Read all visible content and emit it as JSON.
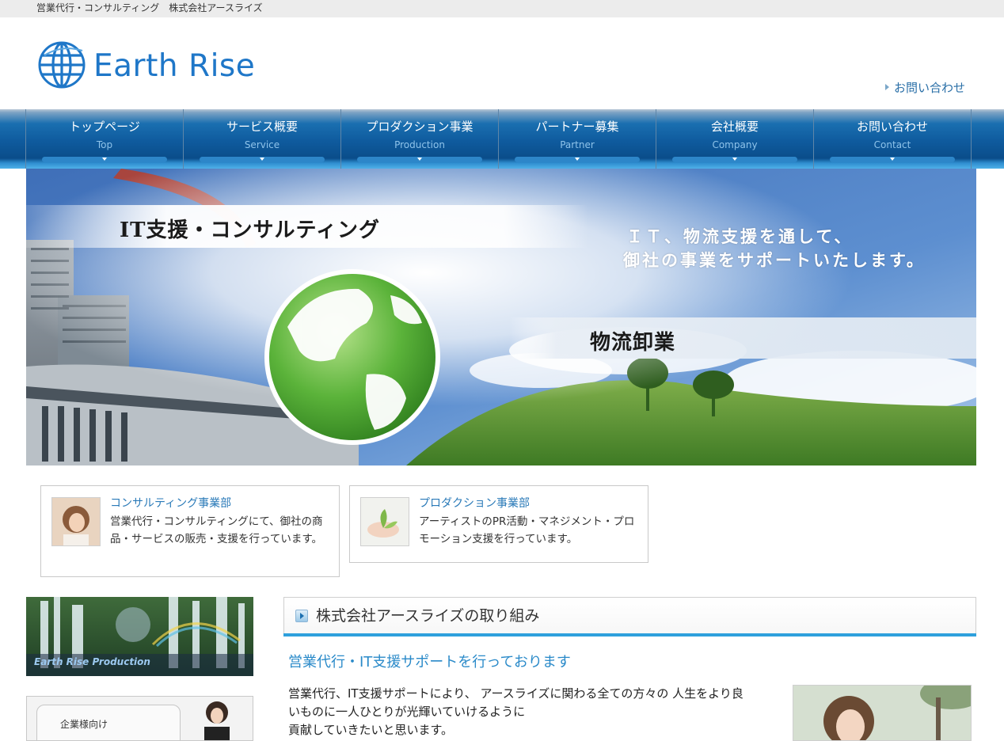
{
  "topbar": {
    "text": "営業代行・コンサルティング　株式会社アースライズ"
  },
  "header": {
    "logo_text": "Earth Rise",
    "contact_link": "お問い合わせ"
  },
  "nav": {
    "items": [
      {
        "jp": "トップページ",
        "en": "Top"
      },
      {
        "jp": "サービス概要",
        "en": "Service"
      },
      {
        "jp": "プロダクション事業",
        "en": "Production"
      },
      {
        "jp": "パートナー募集",
        "en": "Partner"
      },
      {
        "jp": "会社概要",
        "en": "Company"
      },
      {
        "jp": "お問い合わせ",
        "en": "Contact"
      }
    ]
  },
  "hero": {
    "label_it": "IT支援・コンサルティング",
    "label_logistics": "物流卸業",
    "slogan_line1": "ＩＴ、物流支援を通して、",
    "slogan_line2": "御社の事業をサポートいたします。"
  },
  "cards": [
    {
      "title": "コンサルティング事業部",
      "desc": "営業代行・コンサルティングにて、御社の商品・サービスの販売・支援を行っています。"
    },
    {
      "title": "プロダクション事業部",
      "desc": "アーティストのPR活動・マネジメント・プロモーション支援を行っています。"
    }
  ],
  "sidebar": {
    "banner1_text": "Earth Rise Production",
    "banner2_text": "企業様向け"
  },
  "main": {
    "section_title": "株式会社アースライズの取り組み",
    "sub_heading": "営業代行・IT支援サポートを行っております",
    "body_line1": "営業代行、IT支援サポートにより、 アースライズに関わる全ての方々の 人生をより良",
    "body_line2": "いものに一人ひとりが光輝いていけるように",
    "body_line3": "貢献していきたいと思います。"
  },
  "colors": {
    "accent": "#2ea0dc",
    "link": "#2a7ab8",
    "nav_dark": "#0f5b9e"
  }
}
